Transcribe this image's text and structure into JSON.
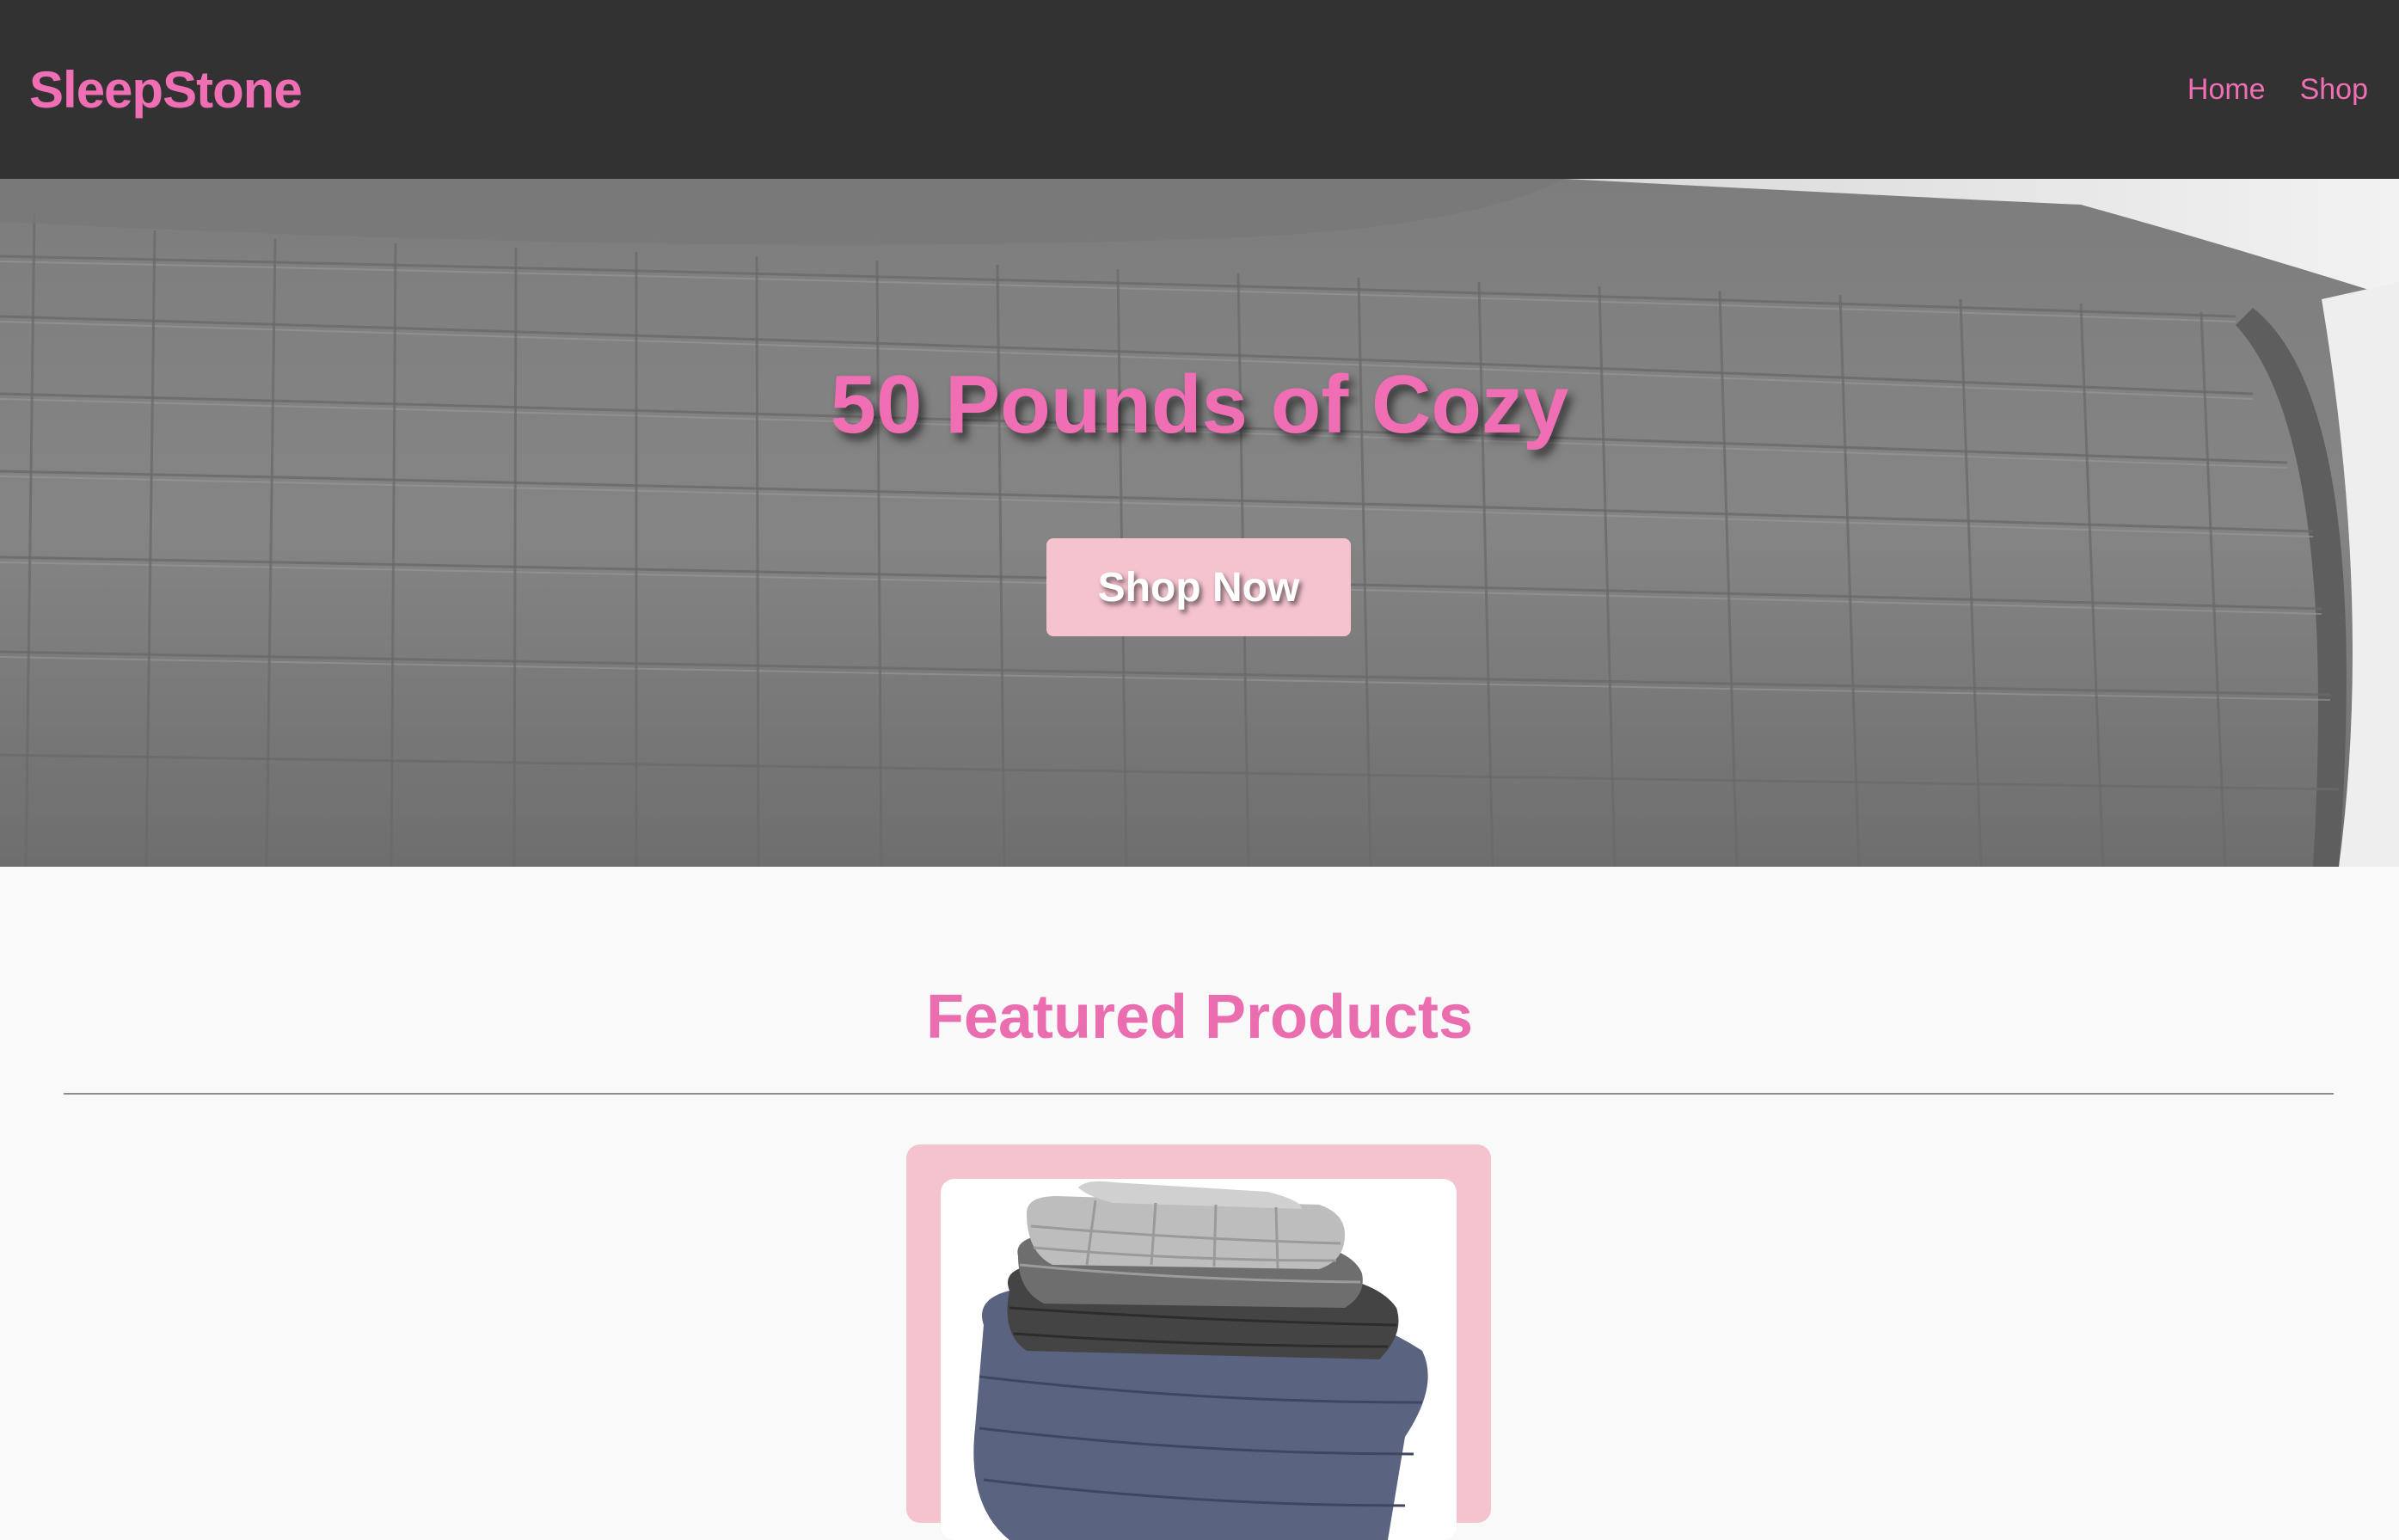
{
  "navbar": {
    "brand": "SleepStone",
    "links": [
      {
        "label": "Home"
      },
      {
        "label": "Shop"
      }
    ]
  },
  "hero": {
    "headline": "50 Pounds of Cozy",
    "cta_label": "Shop Now",
    "image": "weighted-blanket-on-bed"
  },
  "featured": {
    "title": "Featured Products",
    "products": [
      {
        "image": "stacked-weighted-blankets"
      }
    ]
  },
  "colors": {
    "navbar_bg": "#323232",
    "accent_pink": "#f06eb4",
    "button_pink": "#f4c3ce",
    "page_bg": "#f9f9f9"
  }
}
